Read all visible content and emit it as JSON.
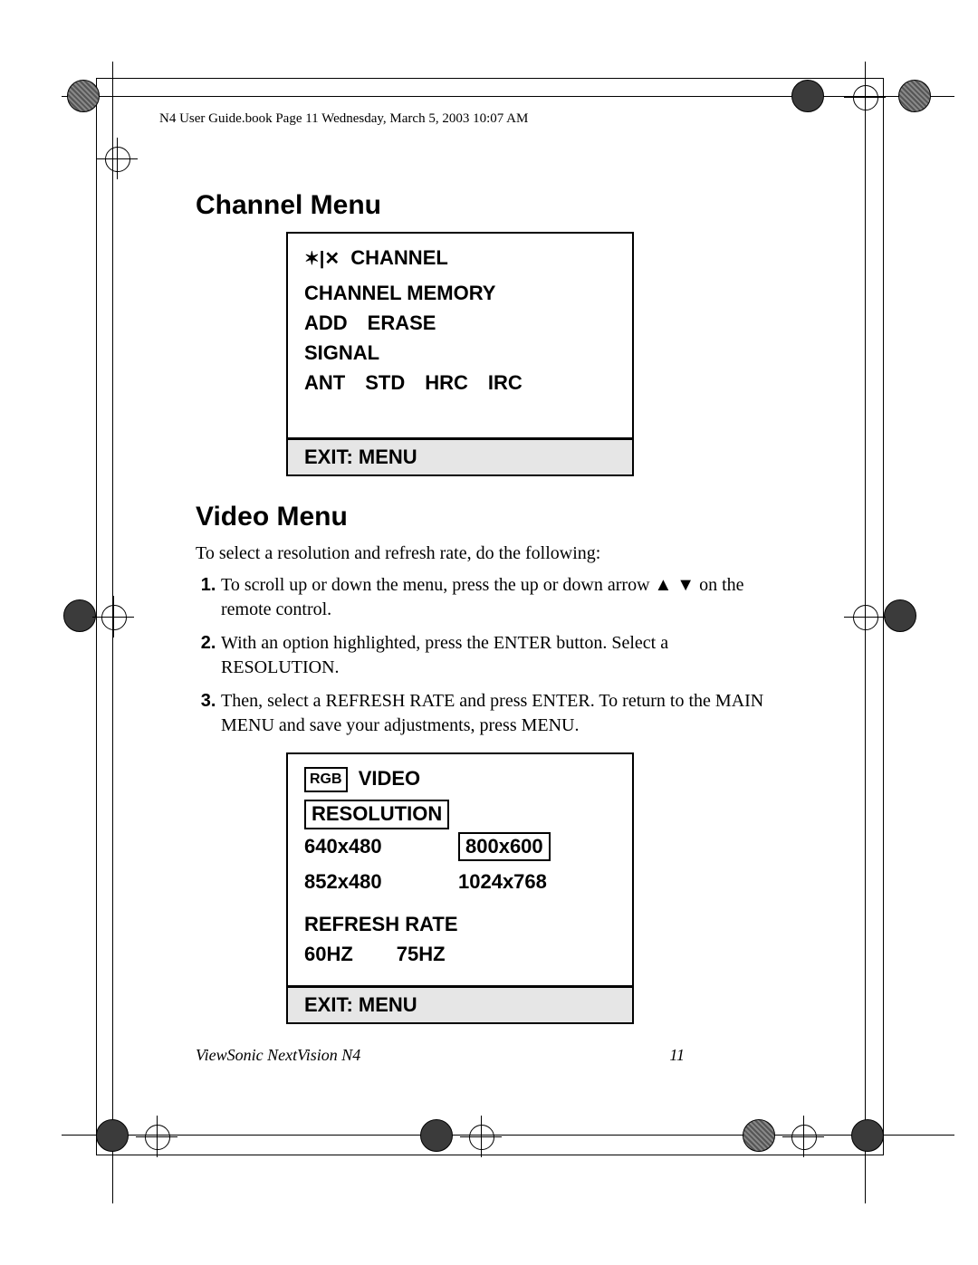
{
  "header_line": "N4 User Guide.book  Page 11  Wednesday, March 5, 2003  10:07 AM",
  "section1_title": "Channel Menu",
  "channel_menu": {
    "title": "CHANNEL",
    "line1": "CHANNEL MEMORY",
    "add": "ADD",
    "erase": "ERASE",
    "signal": "SIGNAL",
    "opts": [
      "ANT",
      "STD",
      "HRC",
      "IRC"
    ],
    "exit": "EXIT:  MENU"
  },
  "section2_title": "Video Menu",
  "video_intro": "To select a resolution and refresh rate, do the following:",
  "steps": [
    "To scroll up or down the menu, press the up or down arrow ▲ ▼ on the remote control.",
    "With an option highlighted, press the ENTER button. Select a RESOLUTION.",
    "Then, select a REFRESH RATE and press ENTER. To return to the MAIN MENU and save your adjustments, press MENU."
  ],
  "video_menu": {
    "rgb": "RGB",
    "title": "VIDEO",
    "resolution_label": "RESOLUTION",
    "res": [
      "640x480",
      "800x600",
      "852x480",
      "1024x768"
    ],
    "refresh_label": "REFRESH RATE",
    "rates": [
      "60HZ",
      "75HZ"
    ],
    "exit": "EXIT:  MENU"
  },
  "footer_left": "ViewSonic   NextVision N4",
  "footer_page": "11"
}
